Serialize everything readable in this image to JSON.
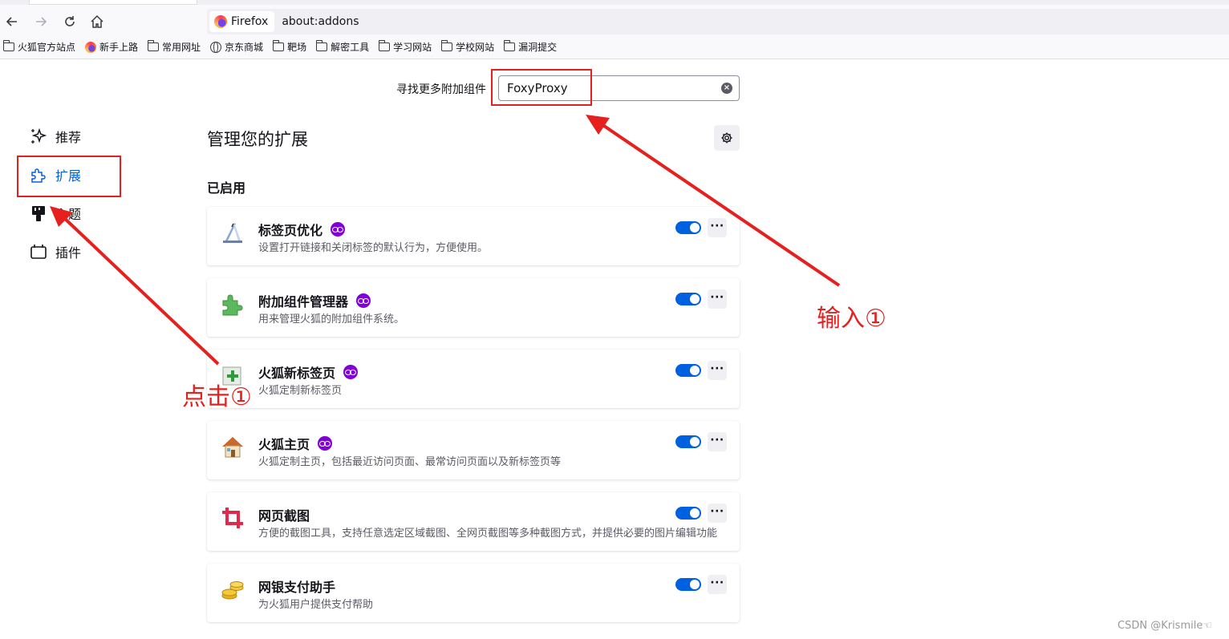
{
  "browser": {
    "tab_label": "Firefox",
    "url": "about:addons",
    "bookmarks": [
      {
        "label": "火狐官方站点",
        "icon": "folder-icon"
      },
      {
        "label": "新手上路",
        "icon": "firefox-icon"
      },
      {
        "label": "常用网址",
        "icon": "folder-icon"
      },
      {
        "label": "京东商城",
        "icon": "globe-icon"
      },
      {
        "label": "靶场",
        "icon": "folder-icon"
      },
      {
        "label": "解密工具",
        "icon": "folder-icon"
      },
      {
        "label": "学习网站",
        "icon": "folder-icon"
      },
      {
        "label": "学校网站",
        "icon": "folder-icon"
      },
      {
        "label": "漏洞提交",
        "icon": "folder-icon"
      }
    ]
  },
  "search": {
    "label": "寻找更多附加组件",
    "value": "FoxyProxy"
  },
  "sidebar": {
    "items": [
      {
        "label": "推荐",
        "icon": "sparkle-icon"
      },
      {
        "label": "扩展",
        "icon": "puzzle-icon"
      },
      {
        "label": "主题",
        "icon": "brush-icon"
      },
      {
        "label": "插件",
        "icon": "plugin-icon"
      }
    ]
  },
  "main": {
    "title": "管理您的扩展",
    "section_enabled": "已启用",
    "extensions": [
      {
        "name": "标签页优化",
        "desc": "设置打开链接和关闭标签的默认行为，方便使用。",
        "badge": true,
        "enabled": true,
        "icon": "tab-tweak-icon"
      },
      {
        "name": "附加组件管理器",
        "desc": "用来管理火狐的附加组件系统。",
        "badge": true,
        "enabled": true,
        "icon": "puzzle-green-icon"
      },
      {
        "name": "火狐新标签页",
        "desc": "火狐定制新标签页",
        "badge": true,
        "enabled": true,
        "icon": "new-tab-icon"
      },
      {
        "name": "火狐主页",
        "desc": "火狐定制主页，包括最近访问页面、最常访问页面以及新标签页等",
        "badge": true,
        "enabled": true,
        "icon": "house-icon"
      },
      {
        "name": "网页截图",
        "desc": "方便的截图工具，支持任意选定区域截图、全网页截图等多种截图方式，并提供必要的图片编辑功能",
        "badge": false,
        "enabled": true,
        "icon": "crop-icon"
      },
      {
        "name": "网银支付助手",
        "desc": "为火狐用户提供支付帮助",
        "badge": false,
        "enabled": true,
        "icon": "coins-icon"
      }
    ],
    "more_label": "···"
  },
  "annotations": {
    "input_label": "输入①",
    "click_label": "点击①",
    "color": "#e5201e"
  },
  "watermark": "CSDN @Krismile☜"
}
